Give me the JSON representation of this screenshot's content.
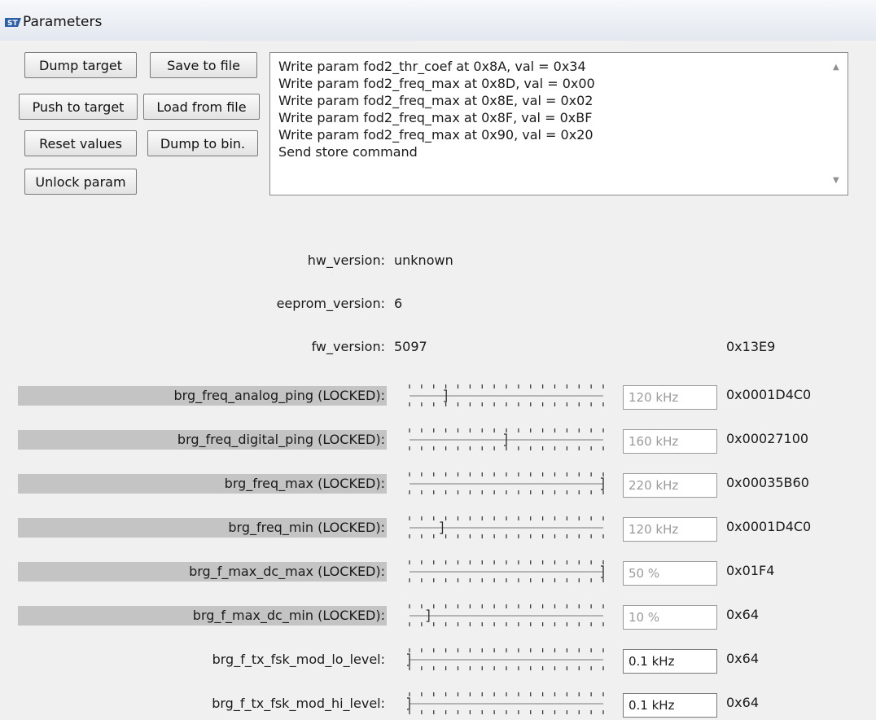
{
  "window": {
    "title": "Parameters"
  },
  "buttons": {
    "dump_target": "Dump target",
    "save_to_file": "Save to file",
    "push_to_target": "Push to target",
    "load_from_file": "Load from file",
    "reset_values": "Reset values",
    "dump_to_bin": "Dump to bin.",
    "unlock_param": "Unlock param"
  },
  "log": {
    "lines": [
      "Write param fod2_thr_coef at 0x8A, val = 0x34",
      "Write param fod2_freq_max at 0x8D, val = 0x00",
      "Write param fod2_freq_max at 0x8E, val = 0x02",
      "Write param fod2_freq_max at 0x8F, val = 0xBF",
      "Write param fod2_freq_max at 0x90, val = 0x20",
      "Send store command"
    ]
  },
  "info": [
    {
      "label": "hw_version:",
      "value": "unknown",
      "hex": ""
    },
    {
      "label": "eeprom_version:",
      "value": "6",
      "hex": ""
    },
    {
      "label": "fw_version:",
      "value": "5097",
      "hex": "0x13E9"
    }
  ],
  "params": [
    {
      "label": "brg_freq_analog_ping (LOCKED):",
      "locked": true,
      "level": 0.19,
      "value": "120 kHz",
      "hex": "0x0001D4C0"
    },
    {
      "label": "brg_freq_digital_ping (LOCKED):",
      "locked": true,
      "level": 0.5,
      "value": "160 kHz",
      "hex": "0x00027100"
    },
    {
      "label": "brg_freq_max (LOCKED):",
      "locked": true,
      "level": 1.0,
      "value": "220 kHz",
      "hex": "0x00035B60"
    },
    {
      "label": "brg_freq_min (LOCKED):",
      "locked": true,
      "level": 0.17,
      "value": "120 kHz",
      "hex": "0x0001D4C0"
    },
    {
      "label": "brg_f_max_dc_max (LOCKED):",
      "locked": true,
      "level": 1.0,
      "value": "50 %",
      "hex": "0x01F4"
    },
    {
      "label": "brg_f_max_dc_min (LOCKED):",
      "locked": true,
      "level": 0.1,
      "value": "10 %",
      "hex": "0x64"
    },
    {
      "label": "brg_f_tx_fsk_mod_lo_level:",
      "locked": false,
      "level": 0.0,
      "value": "0.1 kHz",
      "hex": "0x64"
    },
    {
      "label": "brg_f_tx_fsk_mod_hi_level:",
      "locked": false,
      "level": 0.0,
      "value": "0.1 kHz",
      "hex": "0x64"
    }
  ]
}
